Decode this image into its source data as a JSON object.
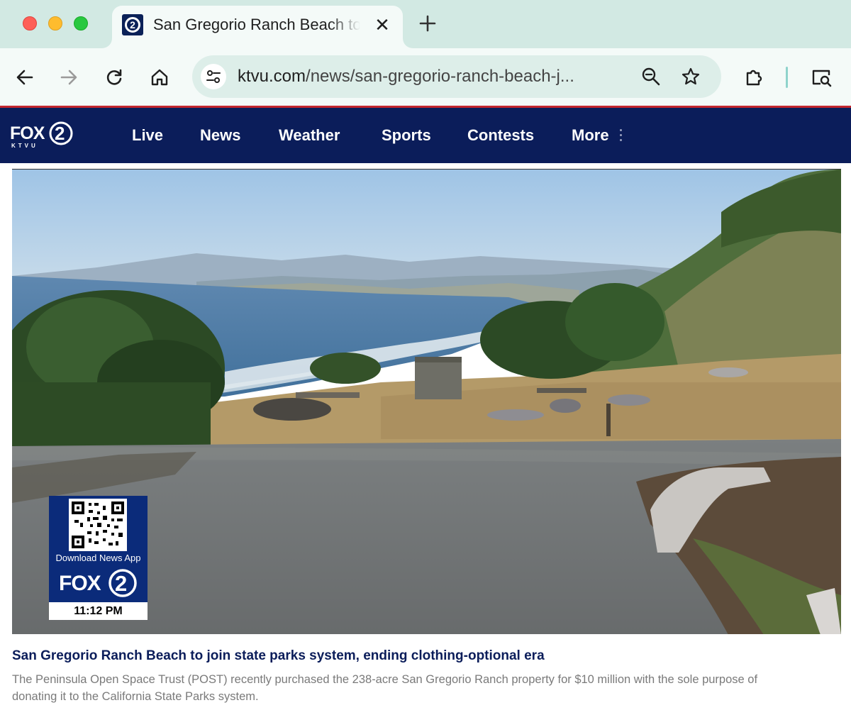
{
  "browser": {
    "tab": {
      "title": "San Gregorio Ranch Beach to join state parks system, ending clothing-optional era",
      "favicon": "fox2-favicon-icon",
      "close_icon": "close-icon"
    },
    "new_tab_icon": "plus-icon",
    "url_domain": "ktvu.com",
    "url_path": "/news/san-gregorio-ranch-beach-j...",
    "colors": {
      "tabstrip": "#d2e9e3",
      "toolbar": "#f4faf8",
      "omnibox": "#ddeee9"
    }
  },
  "site": {
    "logo_text": "FOX",
    "logo_sub": "KTVU",
    "nav": [
      "Live",
      "News",
      "Weather",
      "Sports",
      "Contests",
      "More"
    ],
    "colors": {
      "nav_bg": "#0b1d5a",
      "accent_red": "#c4262e"
    }
  },
  "hero": {
    "badge": {
      "label": "Download News App",
      "logo_text": "FOX",
      "time": "11:12 PM"
    }
  },
  "article": {
    "headline": "San Gregorio Ranch Beach to join state parks system, ending clothing-optional era",
    "summary": "The Peninsula Open Space Trust (POST) recently purchased the 238-acre San Gregorio Ranch property for $10 million with the sole purpose of donating it to the California State Parks system."
  }
}
